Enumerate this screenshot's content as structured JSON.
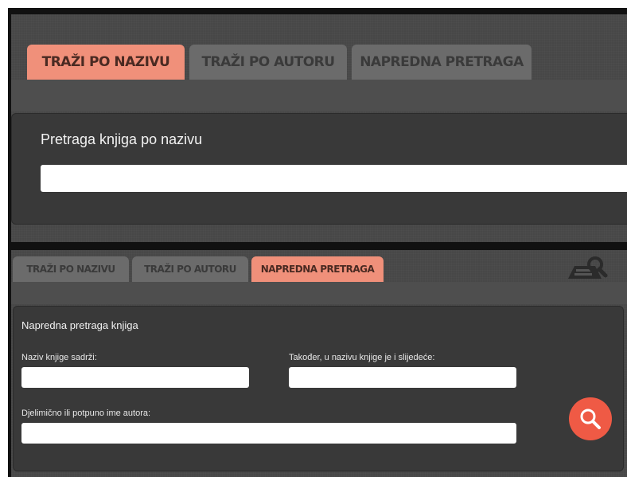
{
  "top": {
    "tabs": [
      {
        "label": "TRAŽI PO NAZIVU",
        "active": true
      },
      {
        "label": "TRAŽI PO AUTORU",
        "active": false
      },
      {
        "label": "NAPREDNA PRETRAGA",
        "active": false
      }
    ],
    "section_title": "Pretraga knjiga po nazivu",
    "search_value": ""
  },
  "bottom": {
    "tabs": [
      {
        "label": "TRAŽI PO NAZIVU",
        "active": false
      },
      {
        "label": "TRAŽI PO AUTORU",
        "active": false
      },
      {
        "label": "NAPREDNA PRETRAGA",
        "active": true
      }
    ],
    "section_title": "Napredna pretraga knjiga",
    "fields": {
      "title_contains_label": "Naziv knjige sadrži:",
      "title_also_label": "Također, u nazivu knjige je i slijedeće:",
      "author_label": "Djelimično ili potpuno ime autora:"
    },
    "icons": {
      "corner": "search-device-icon",
      "submit": "magnifier-icon"
    }
  },
  "colors": {
    "active_tab": "#f0907a",
    "inactive_tab": "#6b6b6b",
    "panel": "#474747",
    "search_button": "#ef5a45"
  }
}
